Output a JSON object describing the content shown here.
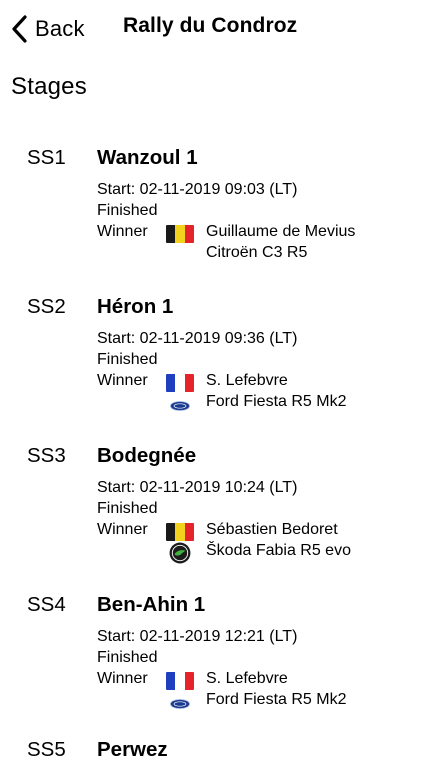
{
  "nav": {
    "back_label": "Back",
    "title": "Rally du Condroz"
  },
  "section_title": "Stages",
  "colors": {
    "belgium": [
      "#1a1a1a",
      "#f2d21c",
      "#e4232b"
    ],
    "france": [
      "#1f3fbf",
      "#ffffff",
      "#e4232b"
    ]
  },
  "stages": [
    {
      "code": "SS1",
      "name": "Wanzoul 1",
      "start": "Start: 02-11-2019 09:03 (LT)",
      "status": "Finished",
      "winner_label": "Winner",
      "flag": "belgium-flag",
      "driver": "Guillaume de Mevius",
      "car": "Citroën C3 R5",
      "car_logo": ""
    },
    {
      "code": "SS2",
      "name": "Héron 1",
      "start": "Start: 02-11-2019 09:36 (LT)",
      "status": "Finished",
      "winner_label": "Winner",
      "flag": "france-flag",
      "driver": "S. Lefebvre",
      "car": "Ford Fiesta R5 Mk2",
      "car_logo": "ford-logo-icon"
    },
    {
      "code": "SS3",
      "name": "Bodegnée",
      "start": "Start: 02-11-2019 10:24 (LT)",
      "status": "Finished",
      "winner_label": "Winner",
      "flag": "belgium-flag",
      "driver": "Sébastien Bedoret",
      "car": "Škoda Fabia R5 evo",
      "car_logo": "skoda-logo-icon"
    },
    {
      "code": "SS4",
      "name": "Ben-Ahin 1",
      "start": "Start: 02-11-2019 12:21 (LT)",
      "status": "Finished",
      "winner_label": "Winner",
      "flag": "france-flag",
      "driver": "S. Lefebvre",
      "car": "Ford Fiesta R5 Mk2",
      "car_logo": "ford-logo-icon"
    },
    {
      "code": "SS5",
      "name": "Perwez"
    }
  ]
}
